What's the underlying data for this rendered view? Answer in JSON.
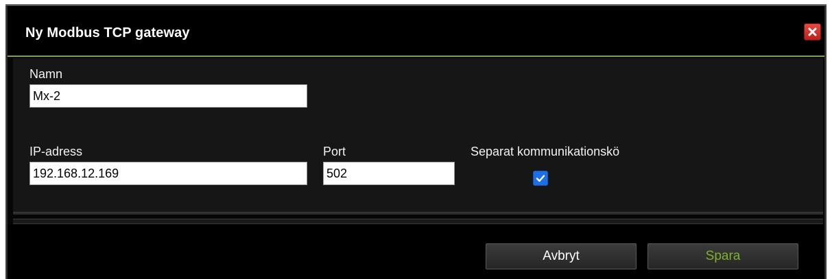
{
  "dialog": {
    "title": "Ny Modbus TCP gateway",
    "close_icon": "close-icon"
  },
  "form": {
    "name_label": "Namn",
    "name_value": "Mx-2",
    "ip_label": "IP-adress",
    "ip_value": "192.168.12.169",
    "port_label": "Port",
    "port_value": "502",
    "separate_queue_label": "Separat kommunikationskö",
    "separate_queue_checked": true
  },
  "footer": {
    "cancel_label": "Avbryt",
    "save_label": "Spara"
  },
  "colors": {
    "accent_green": "#7ca53a",
    "save_text": "#7fb02d",
    "close_red": "#d8352e",
    "checkbox_blue": "#1c6fe6"
  }
}
